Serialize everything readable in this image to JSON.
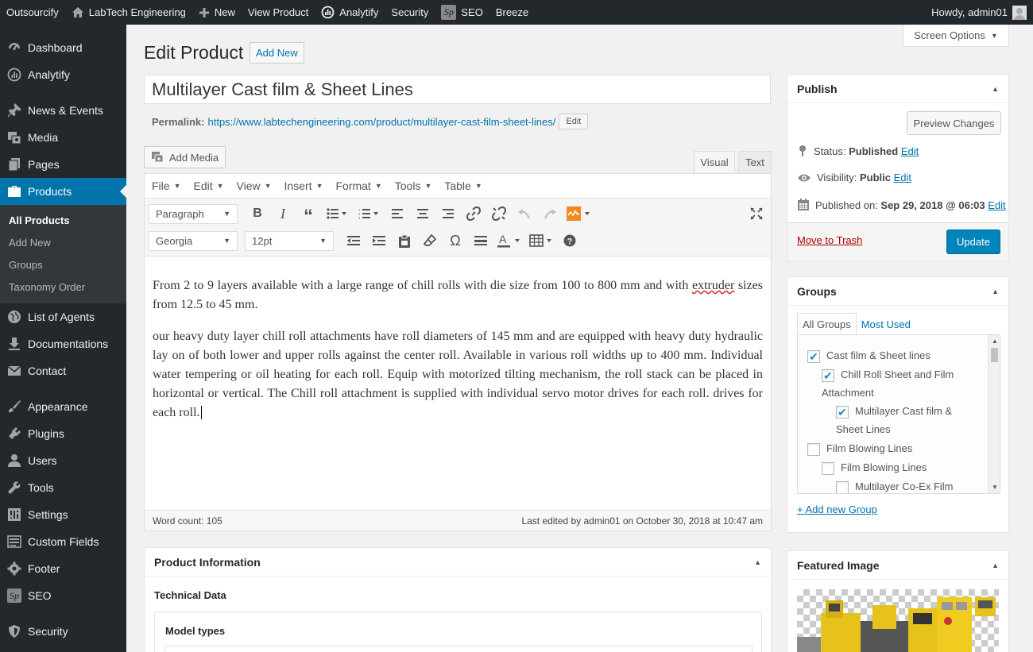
{
  "adminbar": {
    "site": "Outsourcify",
    "home": "LabTech Engineering",
    "new": "New",
    "view_product": "View Product",
    "analytify": "Analytify",
    "security": "Security",
    "seo": "SEO",
    "seo_badge": "Sp",
    "breeze": "Breeze",
    "howdy": "Howdy, admin01"
  },
  "sidebar": {
    "items": [
      {
        "label": "Dashboard",
        "icon": "dashboard-icon"
      },
      {
        "label": "Analytify",
        "icon": "analytics-icon"
      },
      {
        "label": "News & Events",
        "icon": "pin-icon"
      },
      {
        "label": "Media",
        "icon": "media-icon"
      },
      {
        "label": "Pages",
        "icon": "pages-icon"
      },
      {
        "label": "Products",
        "icon": "briefcase-icon"
      },
      {
        "label": "List of Agents",
        "icon": "globe-icon"
      },
      {
        "label": "Documentations",
        "icon": "download-icon"
      },
      {
        "label": "Contact",
        "icon": "mail-icon"
      },
      {
        "label": "Appearance",
        "icon": "brush-icon"
      },
      {
        "label": "Plugins",
        "icon": "plugin-icon"
      },
      {
        "label": "Users",
        "icon": "users-icon"
      },
      {
        "label": "Tools",
        "icon": "wrench-icon"
      },
      {
        "label": "Settings",
        "icon": "settings-icon"
      },
      {
        "label": "Custom Fields",
        "icon": "fields-icon"
      },
      {
        "label": "Footer",
        "icon": "gear-icon"
      },
      {
        "label": "SEO",
        "icon": "seo-icon"
      },
      {
        "label": "Security",
        "icon": "shield-icon"
      }
    ],
    "submenu": [
      "All Products",
      "Add New",
      "Groups",
      "Taxonomy Order"
    ]
  },
  "screen_options": "Screen Options",
  "page": {
    "title": "Edit Product",
    "add_new": "Add New",
    "post_title": "Multilayer Cast film & Sheet Lines",
    "permalink_label": "Permalink:",
    "permalink_base": "https://www.labtechengineering.com/product/",
    "permalink_slug": "multilayer-cast-film-sheet-lines",
    "permalink_end": "/",
    "permalink_edit": "Edit"
  },
  "editor": {
    "add_media": "Add Media",
    "tab_visual": "Visual",
    "tab_text": "Text",
    "menus": [
      "File",
      "Edit",
      "View",
      "Insert",
      "Format",
      "Tools",
      "Table"
    ],
    "format_select": "Paragraph",
    "font_select": "Georgia",
    "size_select": "12pt",
    "p1_a": "From 2 to 9 layers available with a large range of chill rolls with die size from 100 to 800 mm and with ",
    "p1_squig": "extruder",
    "p1_b": " sizes from 12.5 to 45 mm.",
    "p2": "our heavy duty layer chill roll attachments have roll diameters of 145 mm and are equipped with heavy duty hydraulic lay on of both lower and upper rolls against the center roll. Available in various roll widths up to 400 mm. Individual water tempering or oil heating for each roll. Equip with motorized tilting mechanism, the roll stack can be placed in horizontal or vertical. The Chill roll attachment is supplied with individual servo motor drives for each roll. drives for each roll.",
    "word_count": "Word count: 105",
    "last_edited": "Last edited by admin01 on October 30, 2018 at 10:47 am"
  },
  "product_info": {
    "title": "Product Information",
    "technical_data": "Technical Data",
    "model_types": "Model types"
  },
  "publish": {
    "title": "Publish",
    "preview": "Preview Changes",
    "status_label": "Status:",
    "status_value": "Published",
    "visibility_label": "Visibility:",
    "visibility_value": "Public",
    "published_label": "Published on:",
    "published_value": "Sep 29, 2018 @ 06:03",
    "edit": "Edit",
    "trash": "Move to Trash",
    "update": "Update"
  },
  "groups": {
    "title": "Groups",
    "tab_all": "All Groups",
    "tab_used": "Most Used",
    "items": [
      {
        "label": "Cast film & Sheet lines",
        "checked": true
      },
      {
        "label": "Chill Roll Sheet and Film",
        "label2": "Attachment",
        "checked": true
      },
      {
        "label": "Multilayer Cast film &",
        "label2": "Sheet Lines",
        "checked": true
      },
      {
        "label": "Film Blowing Lines",
        "checked": false
      },
      {
        "label": "Film Blowing Lines",
        "checked": false
      },
      {
        "label": "Multilayer Co-Ex Film",
        "checked": false
      }
    ],
    "add_new": "+ Add new Group"
  },
  "featured": {
    "title": "Featured Image"
  },
  "colors": {
    "admin_bg": "#23282d",
    "accent": "#0073aa",
    "primary_button": "#0085ba",
    "trash": "#a00"
  }
}
